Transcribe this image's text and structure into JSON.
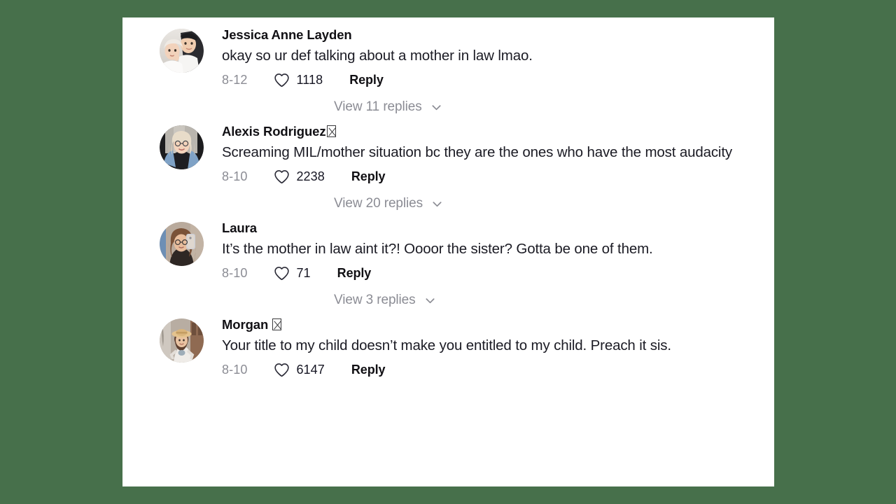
{
  "theme": {
    "page_background": "#47704b",
    "card_background": "#ffffff",
    "text_primary": "#1b1b24",
    "text_muted": "#8b8c94",
    "author_color": "#111014"
  },
  "comments": [
    {
      "author": "Jessica Anne Layden",
      "author_badge": "",
      "text": "okay so ur def talking about a mother in law lmao.",
      "date": "8-12",
      "likes": "1118",
      "reply_label": "Reply",
      "avatar_name": "avatar-jessica-anne-layden",
      "view_replies_label": "View 11 replies",
      "replies_count": "11"
    },
    {
      "author": "Alexis Rodriguez",
      "author_badge": "tofu",
      "text": "Screaming MIL/mother situation bc they are the ones who have the most audacity",
      "date": "8-10",
      "likes": "2238",
      "reply_label": "Reply",
      "avatar_name": "avatar-alexis-rodriguez",
      "view_replies_label": "View 20 replies",
      "replies_count": "20"
    },
    {
      "author": "Laura",
      "author_badge": "",
      "text": "It’s the mother in law aint it?! Oooor the sister? Gotta be one of them.",
      "date": "8-10",
      "likes": "71",
      "reply_label": "Reply",
      "avatar_name": "avatar-laura",
      "view_replies_label": "View 3 replies",
      "replies_count": "3"
    },
    {
      "author": "Morgan ",
      "author_badge": "tofu",
      "text": "Your title to my child doesn’t make you entitled to my child. Preach it sis.",
      "date": "8-10",
      "likes": "6147",
      "reply_label": "Reply",
      "avatar_name": "avatar-morgan",
      "view_replies_label": "",
      "replies_count": ""
    }
  ],
  "icons": {
    "heart": "heart-icon",
    "chevron": "chevron-down-icon"
  }
}
